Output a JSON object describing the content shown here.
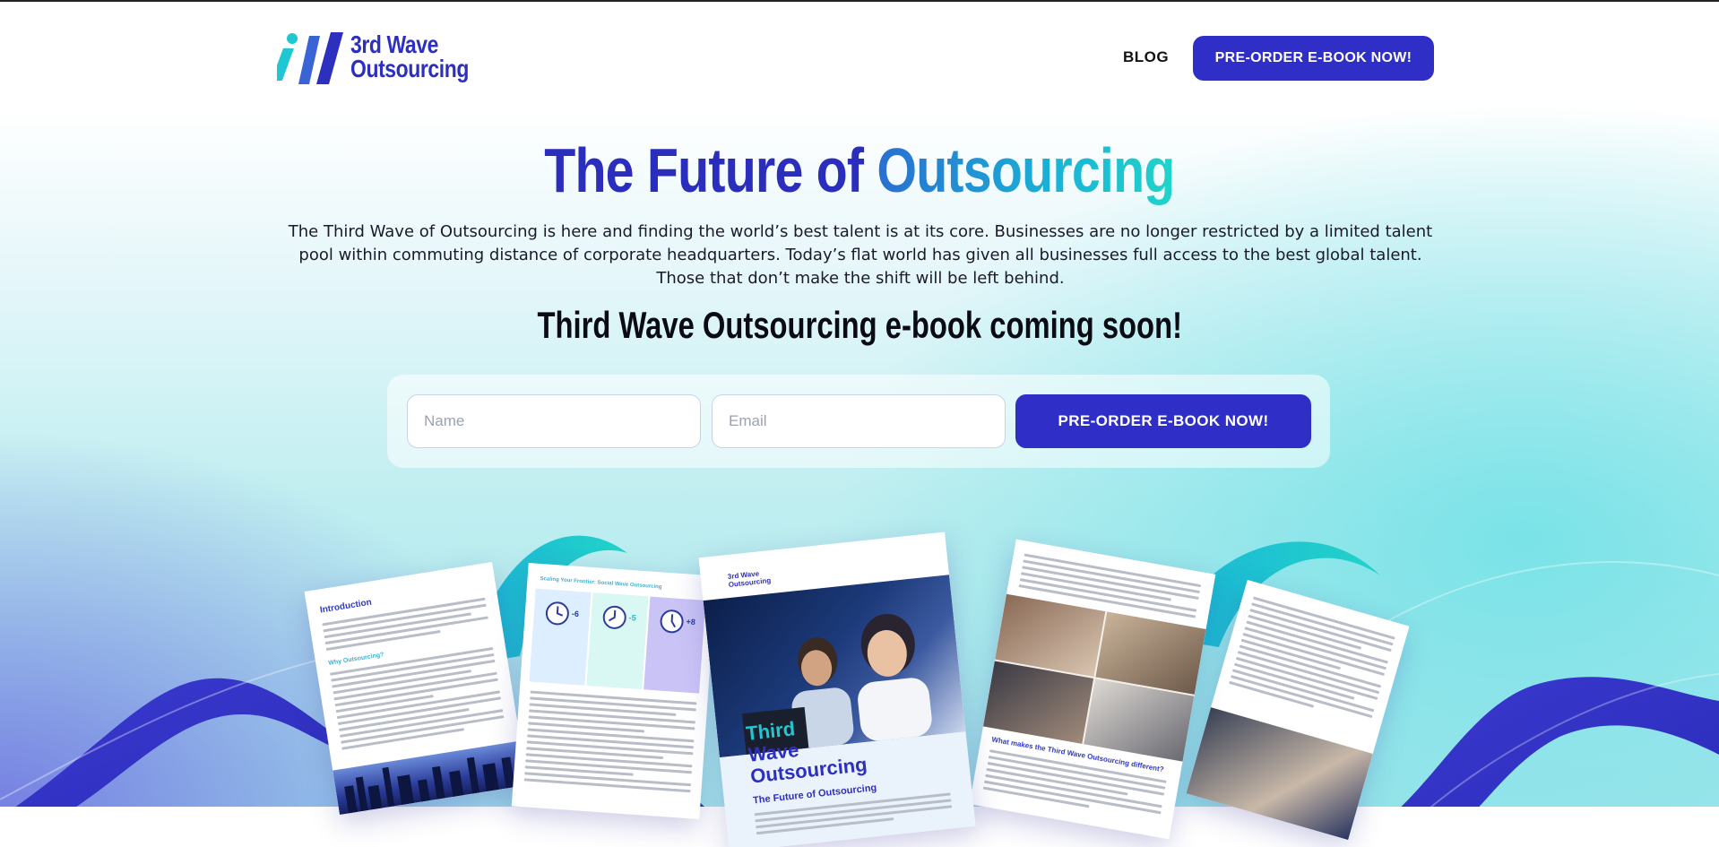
{
  "brand": {
    "name_line1": "3rd Wave",
    "name_line2": "Outsourcing"
  },
  "nav": {
    "blog_label": "BLOG",
    "cta_label": "PRE-ORDER E-BOOK NOW!"
  },
  "hero": {
    "title_part1": "The Future of",
    "title_part2": "Outsourcing",
    "description": "The Third Wave of Outsourcing is here and finding the world’s best talent is at its core. Businesses are no longer restricted by a limited talent pool within commuting distance of corporate headquarters. Today’s flat world has given all businesses full access to the best global talent. Those that don’t make the shift will be left behind.",
    "subtitle": "Third Wave Outsourcing e-book coming soon!"
  },
  "form": {
    "name_placeholder": "Name",
    "email_placeholder": "Email",
    "submit_label": "PRE-ORDER E-BOOK NOW!"
  },
  "ebook_pages": {
    "page1_heading": "Introduction",
    "page1_subheading": "Why Outsourcing?",
    "page2_heading": "Scaling Your Frontier: Social Wave Outsourcing",
    "page2_time_offsets": [
      "-6",
      "-5",
      "+8"
    ],
    "cover_brand": "3rd Wave Outsourcing",
    "cover_title_line1": "Third",
    "cover_title_line2": "Wave",
    "cover_title_line3": "Outsourcing",
    "cover_subtitle": "The Future of Outsourcing",
    "page4_heading": "What makes the Third Wave Outsourcing different?"
  },
  "colors": {
    "primary": "#2f2fc8",
    "teal": "#21d4c9",
    "title_blue": "#2b2dbd"
  }
}
